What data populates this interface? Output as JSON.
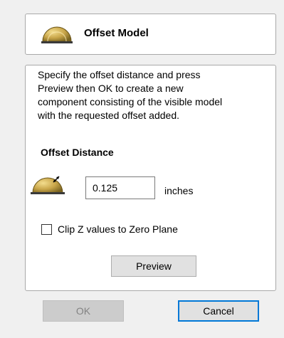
{
  "header": {
    "title": "Offset Model",
    "icon": "dome-model-icon"
  },
  "main": {
    "description": "Specify the offset distance and press\nPreview then OK to create a new\ncomponent consisting of the visible model\nwith the requested offset added.",
    "offset_section": {
      "heading": "Offset Distance",
      "icon": "offset-dome-icon",
      "value": "0.125",
      "units": "inches"
    },
    "clip_option": {
      "label": "Clip Z values to Zero Plane",
      "checked": false
    },
    "preview_label": "Preview"
  },
  "footer": {
    "ok_label": "OK",
    "ok_enabled": false,
    "cancel_label": "Cancel"
  },
  "colors": {
    "dome_gold": "#c9a64a",
    "dome_shadow": "#7a6420",
    "focus_blue": "#0078d7"
  }
}
